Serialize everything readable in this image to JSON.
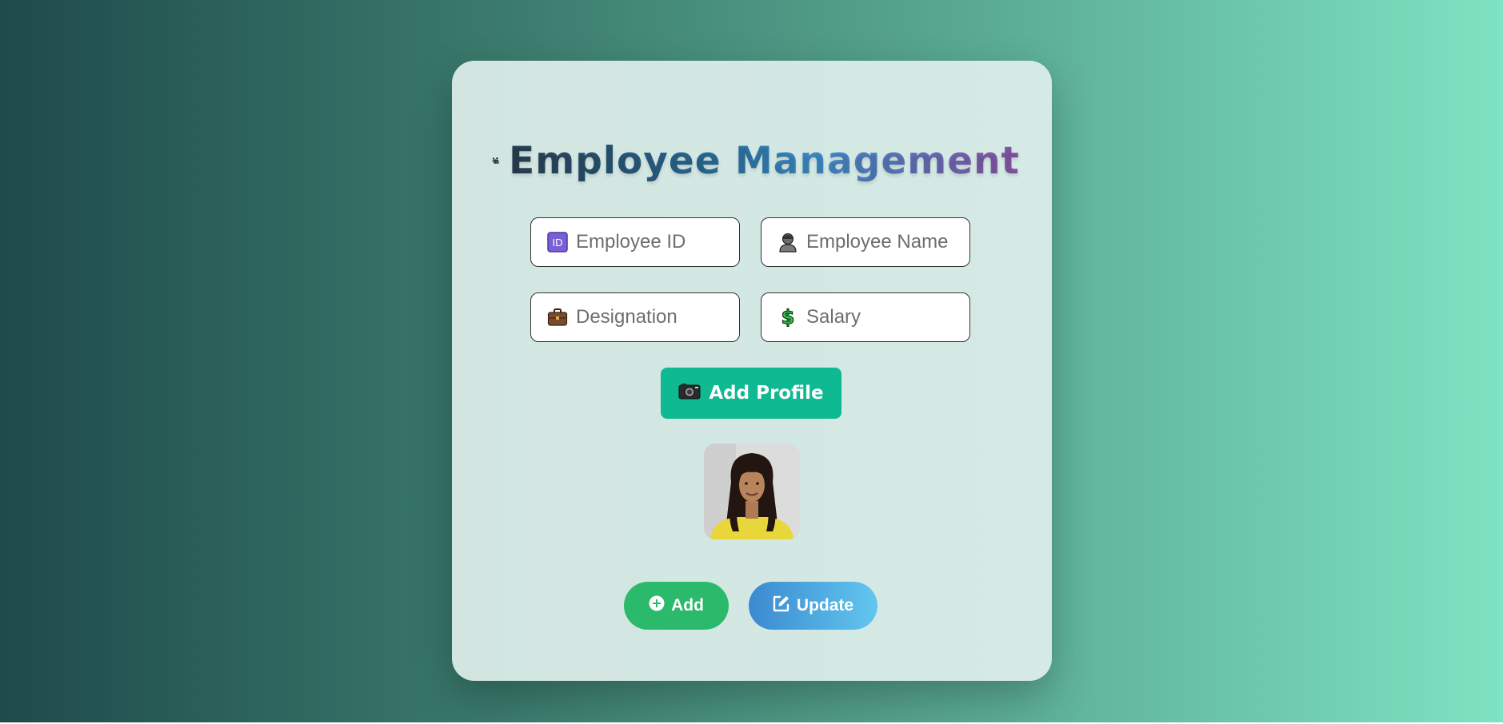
{
  "app": {
    "title": "Employee Management"
  },
  "form": {
    "employee_id": {
      "placeholder": "Employee ID",
      "value": "",
      "icon": "id-badge-icon"
    },
    "employee_name": {
      "placeholder": "Employee Name",
      "value": "",
      "icon": "person-icon"
    },
    "designation": {
      "placeholder": "Designation",
      "value": "",
      "icon": "briefcase-icon"
    },
    "salary": {
      "placeholder": "Salary",
      "value": "",
      "icon": "dollar-sign-icon"
    }
  },
  "profile": {
    "button_label": "Add Profile",
    "icon": "camera-icon"
  },
  "actions": {
    "add_label": "Add",
    "update_label": "Update"
  },
  "colors": {
    "accent_green": "#0fb992",
    "add_green": "#2bba6c",
    "update_blue": "#3b8ad0"
  }
}
